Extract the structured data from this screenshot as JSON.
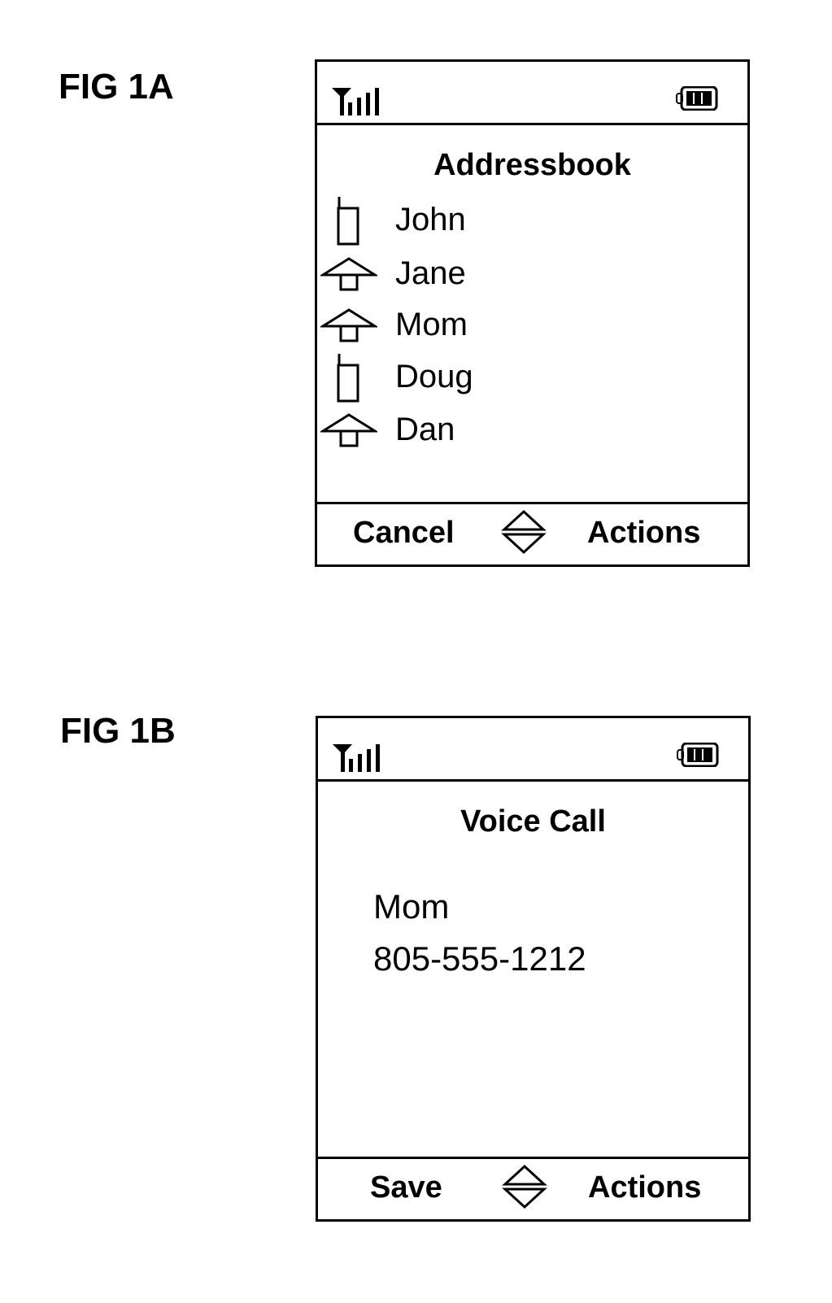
{
  "figures": [
    {
      "label": "FIG 1A",
      "status_bar": {
        "signal_icon": "signal-strength-icon",
        "battery_icon": "battery-icon"
      },
      "title": "Addressbook",
      "contacts": [
        {
          "name": "John",
          "icon": "mobile-phone-icon"
        },
        {
          "name": "Jane",
          "icon": "home-icon"
        },
        {
          "name": "Mom",
          "icon": "home-icon"
        },
        {
          "name": "Doug",
          "icon": "mobile-phone-icon"
        },
        {
          "name": "Dan",
          "icon": "home-icon"
        }
      ],
      "softkeys": {
        "left": "Cancel",
        "center_icon": "up-down-navigation-icon",
        "right": "Actions"
      }
    },
    {
      "label": "FIG 1B",
      "status_bar": {
        "signal_icon": "signal-strength-icon",
        "battery_icon": "battery-icon"
      },
      "title": "Voice Call",
      "contact_name": "Mom",
      "phone_number": "805-555-1212",
      "softkeys": {
        "left": "Save",
        "center_icon": "up-down-navigation-icon",
        "right": "Actions"
      }
    }
  ]
}
